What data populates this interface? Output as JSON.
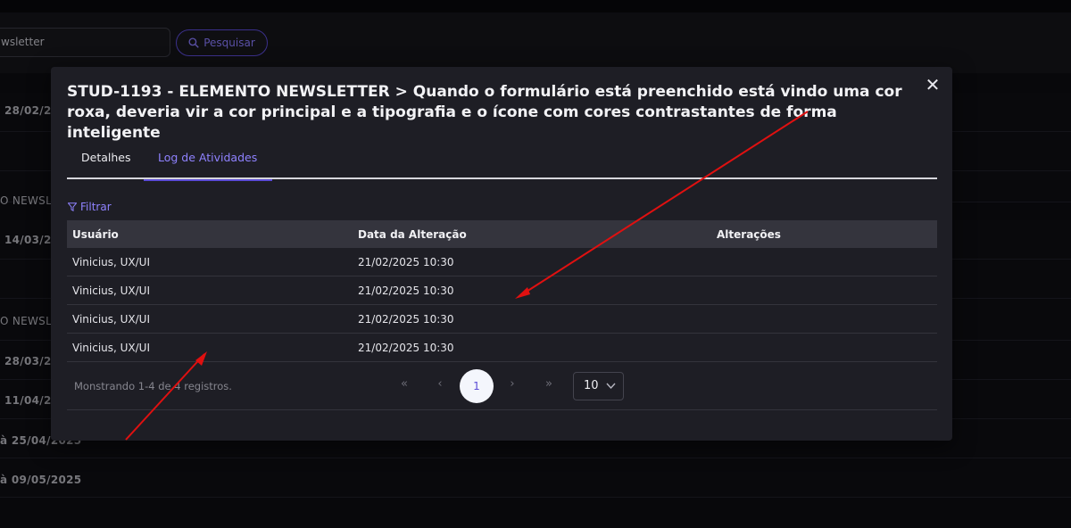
{
  "background": {
    "search_value": "wsletter",
    "search_button_label": "Pesquisar",
    "rows": [
      {
        "text": "28/02/2",
        "bold": true
      },
      {
        "text": "",
        "bold": false
      },
      {
        "text": "O NEWSLE",
        "bold": false
      },
      {
        "text": "14/03/2",
        "bold": true
      },
      {
        "text": "",
        "bold": false
      },
      {
        "text": "O NEWSLE",
        "bold": false
      },
      {
        "text": "28/03/2",
        "bold": true
      },
      {
        "text": "11/04/2",
        "bold": true
      },
      {
        "text": "à 25/04/2025",
        "bold": true
      },
      {
        "text": "à 09/05/2025",
        "bold": true
      }
    ]
  },
  "modal": {
    "title": "STUD-1193 - ELEMENTO NEWSLETTER > Quando o formulário está preenchido está vindo uma cor roxa, deveria vir a cor principal e a tipografia e o ícone com cores contrastantes de forma inteligente",
    "close_label": "✕",
    "tabs": [
      {
        "label": "Detalhes",
        "active": false
      },
      {
        "label": "Log de Atividades",
        "active": true
      }
    ],
    "filter_label": "Filtrar",
    "table": {
      "headers": [
        "Usuário",
        "Data da Alteração",
        "Alterações"
      ],
      "rows": [
        [
          "Vinicius, UX/UI",
          "21/02/2025 10:30",
          ""
        ],
        [
          "Vinicius, UX/UI",
          "21/02/2025 10:30",
          ""
        ],
        [
          "Vinicius, UX/UI",
          "21/02/2025 10:30",
          ""
        ],
        [
          "Vinicius, UX/UI",
          "21/02/2025 10:30",
          ""
        ]
      ]
    },
    "pagination": {
      "info": "Monstrando 1-4 de 4 registros.",
      "first": "«",
      "prev": "‹",
      "current": "1",
      "next": "›",
      "last": "»",
      "page_size": "10"
    }
  },
  "colors": {
    "accent": "#5b4bd6",
    "accent_text": "#8f82ff",
    "annotation_arrow": "#e01010",
    "modal_bg": "#1e1e25"
  }
}
